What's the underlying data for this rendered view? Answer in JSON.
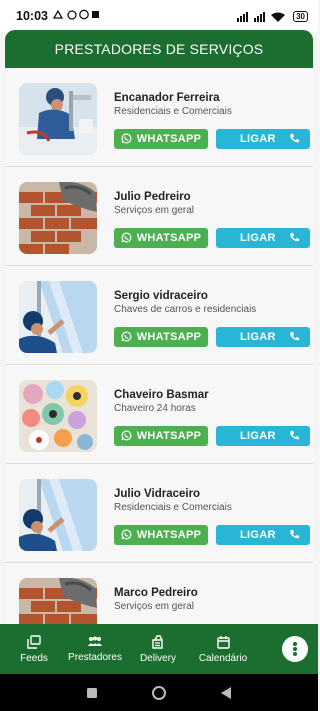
{
  "status": {
    "time": "10:03",
    "battery": "30"
  },
  "header": {
    "title": "PRESTADORES DE SERVIÇOS"
  },
  "providers": [
    {
      "name": "Encanador Ferreira",
      "description": "Residenciais e Comerciais",
      "image": "plumber-photo"
    },
    {
      "name": "Julio Pedreiro",
      "description": "Serviços em geral",
      "image": "bricklayer-photo"
    },
    {
      "name": "Sergio vidraceiro",
      "description": "Chaves de carros e residenciais",
      "image": "glazier-photo"
    },
    {
      "name": "Chaveiro Basmar",
      "description": "Chaveiro 24 horas",
      "image": "keychains-photo"
    },
    {
      "name": "Julio Vidraceiro",
      "description": "Residenciais e Comerciais",
      "image": "glazier-photo"
    },
    {
      "name": "Marco Pedreiro",
      "description": "Serviços em geral",
      "image": "bricklayer-photo"
    }
  ],
  "buttons": {
    "whatsapp": "WHATSAPP",
    "call": "LIGAR"
  },
  "bottom_nav": {
    "feeds": "Feeds",
    "prestadores": "Prestadores",
    "delivery": "Delivery",
    "calendario": "Calendário"
  },
  "colors": {
    "primary": "#1b6e2f",
    "whatsapp": "#4caf50",
    "call": "#29b6d6"
  }
}
